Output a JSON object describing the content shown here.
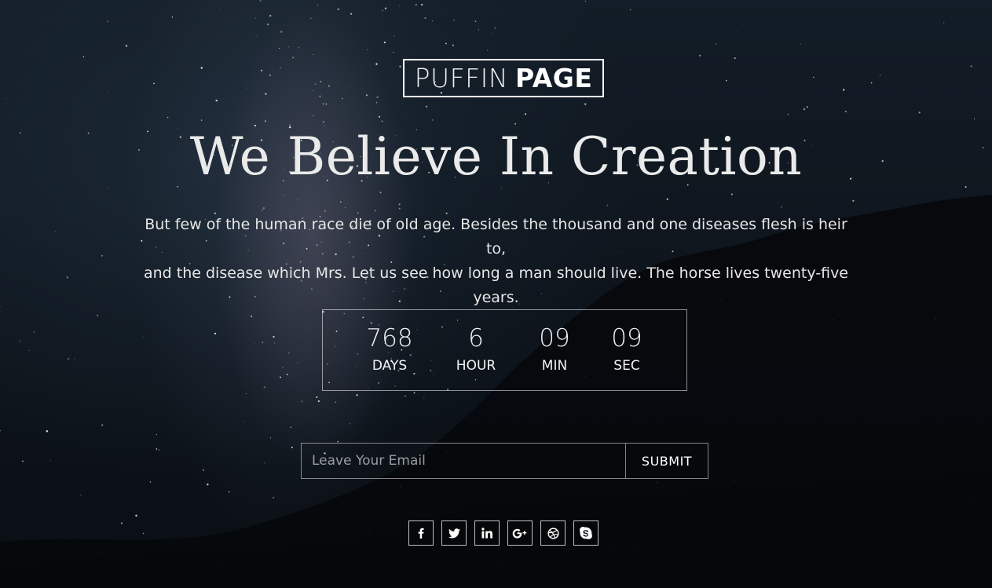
{
  "brand": {
    "name_light": "PUFFIN",
    "name_bold": "PAGE"
  },
  "hero": {
    "headline": "We Believe In Creation",
    "intro_line1": "But few of the human race die of old age. Besides the thousand and one diseases flesh is heir to,",
    "intro_line2": "and the disease which Mrs. Let us see how long a man should live. The horse lives twenty-five years."
  },
  "countdown": {
    "days": {
      "value": "768",
      "label": "DAYS"
    },
    "hours": {
      "value": "6",
      "label": "HOUR"
    },
    "minutes": {
      "value": "09",
      "label": "MIN"
    },
    "seconds": {
      "value": "09",
      "label": "SEC"
    }
  },
  "subscribe": {
    "email_placeholder": "Leave Your Email",
    "email_value": "",
    "submit_label": "SUBMIT"
  },
  "social": [
    {
      "icon": "facebook-icon",
      "glyph": "f"
    },
    {
      "icon": "twitter-icon",
      "glyph": "bird"
    },
    {
      "icon": "linkedin-icon",
      "glyph": "in"
    },
    {
      "icon": "google-plus-icon",
      "glyph": "G+"
    },
    {
      "icon": "dribbble-icon",
      "glyph": "ball"
    },
    {
      "icon": "skype-icon",
      "glyph": "S"
    }
  ],
  "colors": {
    "text": "#ffffff",
    "background": "#0e151d",
    "border": "#ffffff"
  }
}
